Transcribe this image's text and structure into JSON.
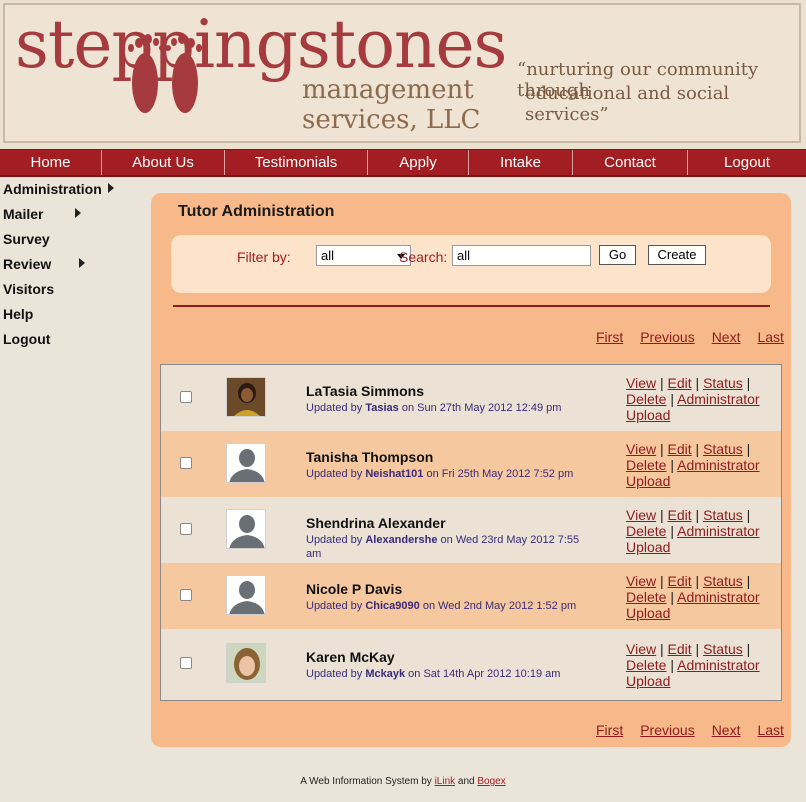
{
  "header": {
    "logo_text": "steppingstones",
    "logo_sub1": "management",
    "logo_sub2": "services, LLC",
    "tagline1": "“nurturing our community through",
    "tagline2": "educational and social services”"
  },
  "nav": [
    "Home",
    "About Us",
    "Testimonials",
    "Apply",
    "Intake",
    "Contact",
    "Logout"
  ],
  "sidebar": [
    {
      "label": "Administration",
      "has_arrow": true
    },
    {
      "label": "Mailer",
      "has_arrow": true
    },
    {
      "label": "Survey",
      "has_arrow": false
    },
    {
      "label": "Review",
      "has_arrow": true
    },
    {
      "label": "Visitors",
      "has_arrow": false
    },
    {
      "label": "Help",
      "has_arrow": false
    },
    {
      "label": "Logout",
      "has_arrow": false
    }
  ],
  "panel": {
    "title": "Tutor Administration",
    "filter_label": "Filter by:",
    "filter_value": "all",
    "search_label": "Search:",
    "search_value": "all",
    "go_label": "Go",
    "create_label": "Create"
  },
  "pager": {
    "first": "First",
    "previous": "Previous",
    "next": "Next",
    "last": "Last"
  },
  "rows": [
    {
      "name": "LaTasia Simmons",
      "prefix": "Updated by ",
      "user": "Tasias",
      "suffix": " on Sun 27th May 2012 12:49 pm",
      "avatar": "photo-dark"
    },
    {
      "name": "Tanisha Thompson",
      "prefix": "Updated by ",
      "user": "Neishat101",
      "suffix": " on Fri 25th May 2012 7:52 pm",
      "avatar": "placeholder"
    },
    {
      "name": "Shendrina Alexander",
      "prefix": "Updated by ",
      "user": "Alexandershe",
      "suffix": " on Wed 23rd May 2012 7:55 am",
      "avatar": "placeholder"
    },
    {
      "name": "Nicole P Davis",
      "prefix": "Updated by ",
      "user": "Chica9090",
      "suffix": " on Wed 2nd May 2012 1:52 pm",
      "avatar": "placeholder"
    },
    {
      "name": "Karen McKay",
      "prefix": "Updated by ",
      "user": "Mckayk",
      "suffix": " on Sat 14th Apr 2012 10:19 am",
      "avatar": "photo-light"
    }
  ],
  "actions": {
    "view": "View",
    "edit": "Edit",
    "status": "Status",
    "delete": "Delete",
    "administrator": "Administrator",
    "upload": "Upload",
    "separator": " | "
  },
  "footer": {
    "prefix": "A Web Information System by ",
    "link1": "iLink",
    "middle": " and ",
    "link2": "Bogex"
  },
  "colors": {
    "nav_bg": "#a31e22",
    "panel_bg": "#f7b98a",
    "link": "#8e1b1e",
    "background": "#ebe4d9"
  }
}
